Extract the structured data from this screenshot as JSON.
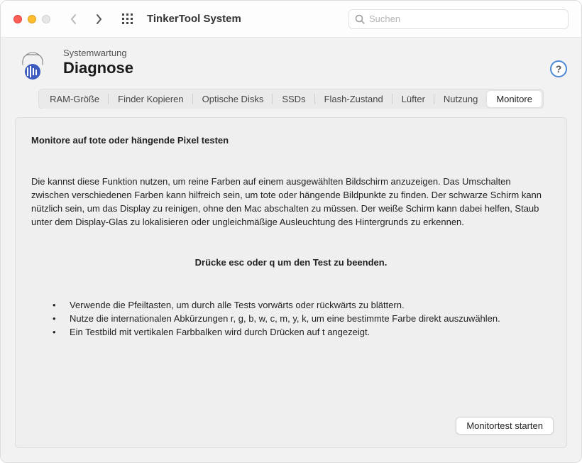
{
  "window": {
    "app_title": "TinkerTool System"
  },
  "search": {
    "placeholder": "Suchen"
  },
  "header": {
    "breadcrumb": "Systemwartung",
    "page_title": "Diagnose"
  },
  "tabs": [
    {
      "label": "RAM-Größe",
      "active": false
    },
    {
      "label": "Finder Kopieren",
      "active": false
    },
    {
      "label": "Optische Disks",
      "active": false
    },
    {
      "label": "SSDs",
      "active": false
    },
    {
      "label": "Flash-Zustand",
      "active": false
    },
    {
      "label": "Lüfter",
      "active": false
    },
    {
      "label": "Nutzung",
      "active": false
    },
    {
      "label": "Monitore",
      "active": true
    }
  ],
  "main": {
    "heading": "Monitore auf tote oder hängende Pixel testen",
    "description": "Die kannst diese Funktion nutzen, um reine Farben auf einem ausgewählten Bildschirm anzuzeigen. Das Umschalten zwischen verschiedenen Farben kann hilfreich sein, um tote oder hängende Bildpunkte zu finden. Der schwarze Schirm kann nützlich sein, um das Display zu reinigen, ohne den Mac abschalten zu müssen. Der weiße Schirm kann dabei helfen, Staub unter dem Display-Glas zu lokalisieren oder ungleichmäßige Ausleuchtung des Hintergrunds zu erkennen.",
    "instruction_heading": "Drücke esc oder q um den Test zu beenden.",
    "bullets": [
      "Verwende die Pfeiltasten, um durch alle Tests vorwärts oder rückwärts zu blättern.",
      "Nutze die internationalen Abkürzungen r, g, b, w, c, m, y, k, um eine bestimmte Farbe direkt auszuwählen.",
      "Ein Testbild mit vertikalen Farbbalken wird durch Drücken auf t angezeigt."
    ],
    "action_button": "Monitortest starten"
  }
}
